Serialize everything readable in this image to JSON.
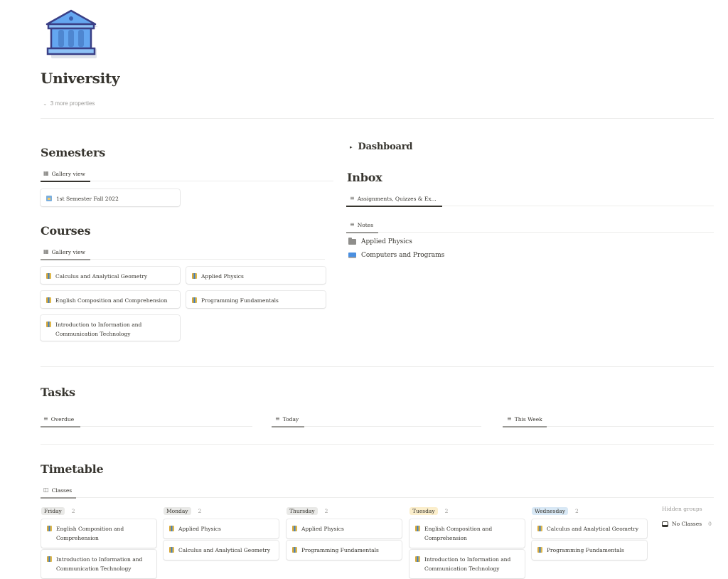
{
  "page": {
    "icon": "classical-building-icon",
    "title": "University",
    "more_properties": "3 more properties"
  },
  "semesters": {
    "heading": "Semesters",
    "view": {
      "icon": "gallery-icon",
      "label": "Gallery view"
    },
    "cards": [
      {
        "icon": "calendar-icon",
        "label": "1st Semester Fall 2022"
      }
    ]
  },
  "courses": {
    "heading": "Courses",
    "view": {
      "icon": "gallery-icon",
      "label": "Gallery view"
    },
    "cards": [
      {
        "icon": "books-icon",
        "label": "Calculus and Analytical Geometry"
      },
      {
        "icon": "books-icon",
        "label": "Applied Physics"
      },
      {
        "icon": "books-icon",
        "label": "English Composition and Comprehension"
      },
      {
        "icon": "books-icon",
        "label": "Programming Fundamentals"
      },
      {
        "icon": "books-icon",
        "label": "Introduction to Information and Communication Technology"
      }
    ]
  },
  "dashboard": {
    "toggle_icon": "triangle-right-icon",
    "label": "Dashboard"
  },
  "inbox": {
    "heading": "Inbox",
    "views": [
      {
        "icon": "list-icon",
        "label": "Assignments, Quizzes & Ex..."
      },
      {
        "icon": "list-icon",
        "label": "Notes"
      }
    ],
    "notes": [
      {
        "icon": "folder-icon",
        "label": "Applied Physics"
      },
      {
        "icon": "computer-icon",
        "label": "Computers and Programs"
      }
    ]
  },
  "tasks": {
    "heading": "Tasks",
    "views": [
      {
        "icon": "list-icon",
        "label": "Overdue"
      },
      {
        "icon": "list-icon",
        "label": "Today"
      },
      {
        "icon": "list-icon",
        "label": "This Week"
      }
    ]
  },
  "timetable": {
    "heading": "Timetable",
    "view": {
      "icon": "board-icon",
      "label": "Classes"
    },
    "groups": [
      {
        "name": "Friday",
        "count": "2",
        "color": "#e9e9e7",
        "cards": [
          "English Composition and Comprehension",
          "Introduction to Information and Communication Technology"
        ]
      },
      {
        "name": "Monday",
        "count": "2",
        "color": "#e9e9e7",
        "cards": [
          "Applied Physics",
          "Calculus and Analytical Geometry"
        ]
      },
      {
        "name": "Thursday",
        "count": "2",
        "color": "#e9e9e7",
        "cards": [
          "Applied Physics",
          "Programming Fundamentals"
        ]
      },
      {
        "name": "Tuesday",
        "count": "2",
        "color": "#fbeecb",
        "cards": [
          "English Composition and Comprehension",
          "Introduction to Information and Communication Technology"
        ]
      },
      {
        "name": "Wednesday",
        "count": "2",
        "color": "#d8e8f5",
        "cards": [
          "Calculus and Analytical Geometry",
          "Programming Fundamentals"
        ]
      }
    ],
    "hidden_groups_label": "Hidden groups",
    "hidden_groups": [
      {
        "icon": "inbox-tray-icon",
        "name": "No Classes",
        "count": "0"
      }
    ]
  }
}
